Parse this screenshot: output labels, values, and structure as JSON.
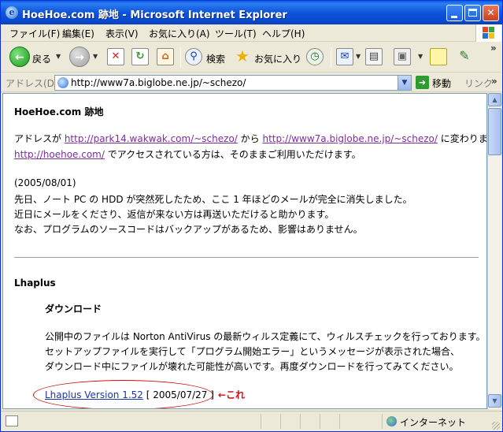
{
  "window": {
    "title": "HoeHoe.com 跡地 - Microsoft Internet Explorer",
    "icon": "ie-icon"
  },
  "menu": {
    "items": [
      "ファイル(F)",
      "編集(E)",
      "表示(V)",
      "お気に入り(A)",
      "ツール(T)",
      "ヘルプ(H)"
    ]
  },
  "toolbar": {
    "back_label": "戻る",
    "search_label": "検索",
    "favorites_label": "お気に入り",
    "more": "»"
  },
  "address": {
    "label": "アドレス(D)",
    "url": "http://www7a.biglobe.ne.jp/~schezo/",
    "go_label": "移動",
    "links_label": "リンク"
  },
  "page": {
    "site_title": "HoeHoe.com 跡地",
    "move_notice": {
      "prefix": "アドレスが ",
      "old_url": "http://park14.wakwak.com/~schezo/",
      "middle": " から ",
      "new_url": "http://www7a.biglobe.ne.jp/~schezo/",
      "suffix": " に変わります。"
    },
    "hoehoe_notice": {
      "url": "http://hoehoe.com/",
      "suffix": " でアクセスされている方は、そのままご利用いただけます。"
    },
    "news_date": "(2005/08/01)",
    "news_lines": [
      "先日、ノート PC の HDD が突然死したため、ここ 1 年ほどのメールが完全に消失しました。",
      "近日にメールをくださり、返信が来ない方は再送いただけると助かります。",
      "なお、プログラムのソースコードはバックアップがあるため、影響はありません。"
    ],
    "section_title": "Lhaplus",
    "download_heading": "ダウンロード",
    "download_lines": [
      "公開中のファイルは Norton AntiVirus の最新ウィルス定義にて、ウィルスチェックを行っております。",
      "セットアップファイルを実行して「プログラム開始エラー」というメッセージが表示された場合、",
      "ダウンロード中にファイルが壊れた可能性が高いです。再度ダウンロードを行ってみてください。"
    ],
    "download_link": "Lhaplus Version 1.52",
    "download_date": " [ 2005/07/27 ]",
    "annotation": "←これ"
  },
  "status": {
    "zone": "インターネット"
  },
  "colors": {
    "titlebar": "#0a4ad0",
    "visited_link": "#7b2d9b",
    "link": "#1a36a8",
    "annotation": "#cc1111"
  }
}
